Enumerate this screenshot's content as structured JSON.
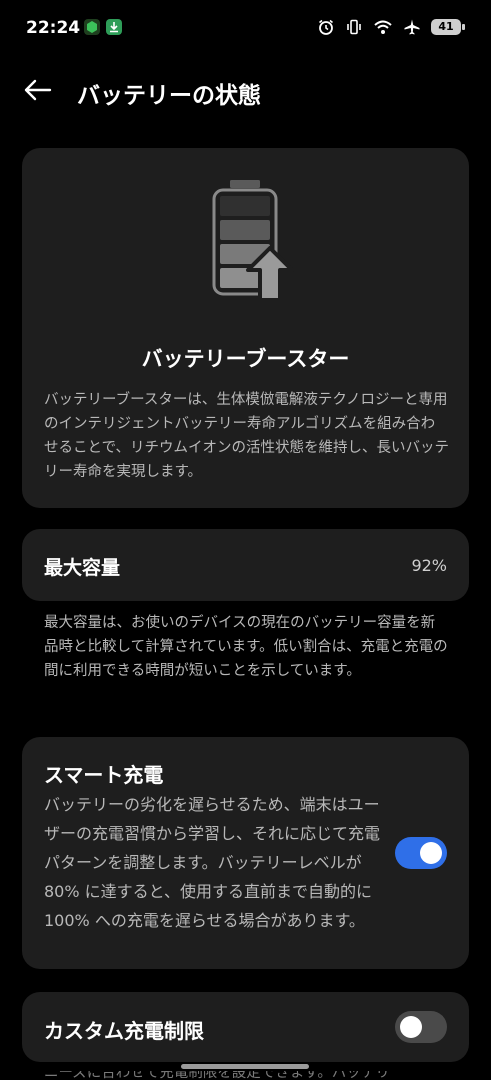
{
  "status_bar": {
    "time": "22:24",
    "battery_level": "41",
    "icons": [
      "alarm-icon",
      "vibrate-icon",
      "wifi-icon",
      "airplane-icon",
      "battery-icon"
    ],
    "notification_icons": [
      "shield-app-icon",
      "download-icon"
    ]
  },
  "app_bar": {
    "title": "バッテリーの状態",
    "back_icon": "arrow-left-icon"
  },
  "battery_booster": {
    "title": "バッテリーブースター",
    "description": "バッテリーブースターは、生体模倣電解液テクノロジーと専用のインテリジェントバッテリー寿命アルゴリズムを組み合わせることで、リチウムイオンの活性状態を維持し、長いバッテリー寿命を実現します。",
    "illustration_icon": "battery-boost-icon"
  },
  "max_capacity": {
    "label": "最大容量",
    "value": "92%",
    "note": "最大容量は、お使いのデバイスの現在のバッテリー容量を新品時と比較して計算されています。低い割合は、充電と充電の間に利用できる時間が短いことを示しています。"
  },
  "smart_charging": {
    "title": "スマート充電",
    "description": "バッテリーの劣化を遅らせるため、端末はユーザーの充電習慣から学習し、それに応じて充電パターンを調整します。バッテリーレベルが 80% に達すると、使用する直前まで自動的に 100% への充電を遅らせる場合があります。",
    "enabled": true
  },
  "custom_charge_limit": {
    "title": "カスタム充電制限",
    "enabled": false,
    "partial_text": "ニーズに合わせて充電制限を設定できます。バッテリ"
  },
  "colors": {
    "background": "#000000",
    "card": "#1e1e1e",
    "accent": "#2f6fe8",
    "toggle_off": "#4a4a4a",
    "secondary_text": "#b8b8b8"
  }
}
